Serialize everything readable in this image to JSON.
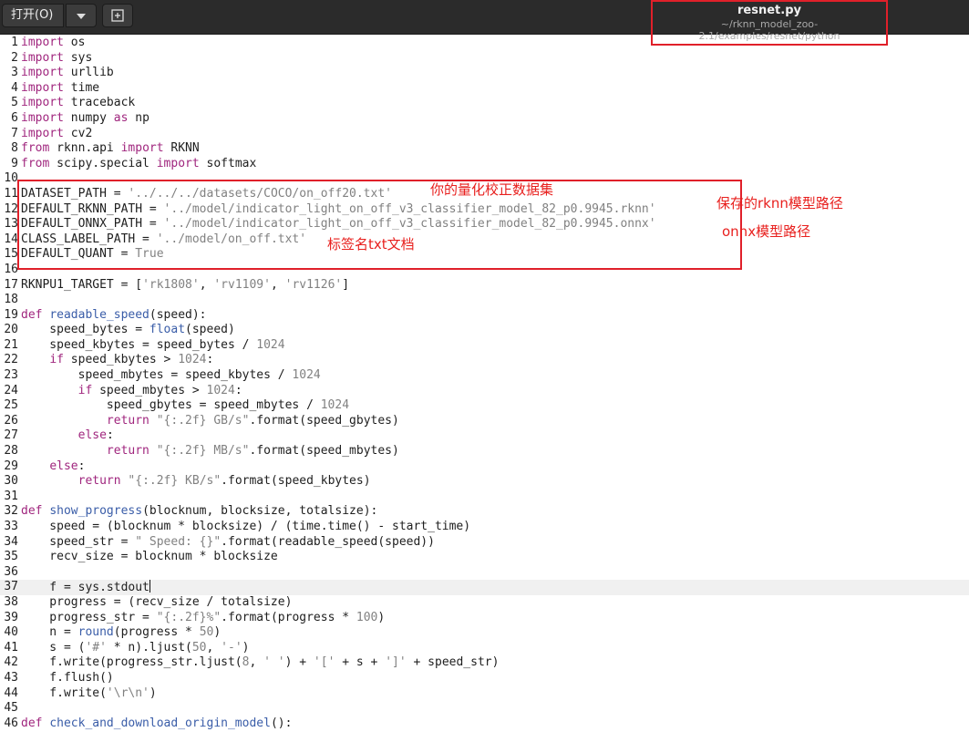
{
  "header": {
    "open_label": "打开(O)",
    "file_name": "resnet.py",
    "file_path": "~/rknn_model_zoo-2.1/examples/resnet/python"
  },
  "icons": {
    "dropdown": "chevron-down-icon",
    "new_tab": "new-tab-icon"
  },
  "colors": {
    "header_bg": "#2b2b2b",
    "annotation_red": "#e0202a",
    "keyword": "#a0267e",
    "string": "#818181",
    "builtin": "#3a5da8"
  },
  "editor": {
    "current_line": 37,
    "lines": [
      [
        {
          "t": "import",
          "c": "kw"
        },
        {
          "t": " os"
        }
      ],
      [
        {
          "t": "import",
          "c": "kw"
        },
        {
          "t": " sys"
        }
      ],
      [
        {
          "t": "import",
          "c": "kw"
        },
        {
          "t": " urllib"
        }
      ],
      [
        {
          "t": "import",
          "c": "kw"
        },
        {
          "t": " time"
        }
      ],
      [
        {
          "t": "import",
          "c": "kw"
        },
        {
          "t": " traceback"
        }
      ],
      [
        {
          "t": "import",
          "c": "kw"
        },
        {
          "t": " numpy "
        },
        {
          "t": "as",
          "c": "kw"
        },
        {
          "t": " np"
        }
      ],
      [
        {
          "t": "import",
          "c": "kw"
        },
        {
          "t": " cv2"
        }
      ],
      [
        {
          "t": "from",
          "c": "kw"
        },
        {
          "t": " rknn.api "
        },
        {
          "t": "import",
          "c": "kw"
        },
        {
          "t": " RKNN"
        }
      ],
      [
        {
          "t": "from",
          "c": "kw"
        },
        {
          "t": " scipy.special "
        },
        {
          "t": "import",
          "c": "kw"
        },
        {
          "t": " softmax"
        }
      ],
      [],
      [
        {
          "t": "DATASET_PATH = "
        },
        {
          "t": "'../../../datasets/COCO/on_off20.txt'",
          "c": "str"
        }
      ],
      [
        {
          "t": "DEFAULT_RKNN_PATH = "
        },
        {
          "t": "'../model/indicator_light_on_off_v3_classifier_model_82_p0.9945.rknn'",
          "c": "str"
        }
      ],
      [
        {
          "t": "DEFAULT_ONNX_PATH = "
        },
        {
          "t": "'../model/indicator_light_on_off_v3_classifier_model_82_p0.9945.onnx'",
          "c": "str"
        }
      ],
      [
        {
          "t": "CLASS_LABEL_PATH = "
        },
        {
          "t": "'../model/on_off.txt'",
          "c": "str"
        }
      ],
      [
        {
          "t": "DEFAULT_QUANT = "
        },
        {
          "t": "True",
          "c": "num"
        }
      ],
      [],
      [
        {
          "t": "RKNPU1_TARGET = ["
        },
        {
          "t": "'rk1808'",
          "c": "str"
        },
        {
          "t": ", "
        },
        {
          "t": "'rv1109'",
          "c": "str"
        },
        {
          "t": ", "
        },
        {
          "t": "'rv1126'",
          "c": "str"
        },
        {
          "t": "]"
        }
      ],
      [],
      [
        {
          "t": "def",
          "c": "kw"
        },
        {
          "t": " "
        },
        {
          "t": "readable_speed",
          "c": "bi"
        },
        {
          "t": "(speed):"
        }
      ],
      [
        {
          "t": "    speed_bytes = "
        },
        {
          "t": "float",
          "c": "bi"
        },
        {
          "t": "(speed)"
        }
      ],
      [
        {
          "t": "    speed_kbytes = speed_bytes / "
        },
        {
          "t": "1024",
          "c": "num"
        }
      ],
      [
        {
          "t": "    "
        },
        {
          "t": "if",
          "c": "kw"
        },
        {
          "t": " speed_kbytes > "
        },
        {
          "t": "1024",
          "c": "num"
        },
        {
          "t": ":"
        }
      ],
      [
        {
          "t": "        speed_mbytes = speed_kbytes / "
        },
        {
          "t": "1024",
          "c": "num"
        }
      ],
      [
        {
          "t": "        "
        },
        {
          "t": "if",
          "c": "kw"
        },
        {
          "t": " speed_mbytes > "
        },
        {
          "t": "1024",
          "c": "num"
        },
        {
          "t": ":"
        }
      ],
      [
        {
          "t": "            speed_gbytes = speed_mbytes / "
        },
        {
          "t": "1024",
          "c": "num"
        }
      ],
      [
        {
          "t": "            "
        },
        {
          "t": "return",
          "c": "kw"
        },
        {
          "t": " "
        },
        {
          "t": "\"{:.2f} GB/s\"",
          "c": "str"
        },
        {
          "t": ".format(speed_gbytes)"
        }
      ],
      [
        {
          "t": "        "
        },
        {
          "t": "else",
          "c": "kw"
        },
        {
          "t": ":"
        }
      ],
      [
        {
          "t": "            "
        },
        {
          "t": "return",
          "c": "kw"
        },
        {
          "t": " "
        },
        {
          "t": "\"{:.2f} MB/s\"",
          "c": "str"
        },
        {
          "t": ".format(speed_mbytes)"
        }
      ],
      [
        {
          "t": "    "
        },
        {
          "t": "else",
          "c": "kw"
        },
        {
          "t": ":"
        }
      ],
      [
        {
          "t": "        "
        },
        {
          "t": "return",
          "c": "kw"
        },
        {
          "t": " "
        },
        {
          "t": "\"{:.2f} KB/s\"",
          "c": "str"
        },
        {
          "t": ".format(speed_kbytes)"
        }
      ],
      [],
      [
        {
          "t": "def",
          "c": "kw"
        },
        {
          "t": " "
        },
        {
          "t": "show_progress",
          "c": "bi"
        },
        {
          "t": "(blocknum, blocksize, totalsize):"
        }
      ],
      [
        {
          "t": "    speed = (blocknum * blocksize) / (time.time() - start_time)"
        }
      ],
      [
        {
          "t": "    speed_str = "
        },
        {
          "t": "\" Speed: {}\"",
          "c": "str"
        },
        {
          "t": ".format(readable_speed(speed))"
        }
      ],
      [
        {
          "t": "    recv_size = blocknum * blocksize"
        }
      ],
      [],
      [
        {
          "t": "    f = sys.stdout"
        }
      ],
      [
        {
          "t": "    progress = (recv_size / totalsize)"
        }
      ],
      [
        {
          "t": "    progress_str = "
        },
        {
          "t": "\"{:.2f}%\"",
          "c": "str"
        },
        {
          "t": ".format(progress * "
        },
        {
          "t": "100",
          "c": "num"
        },
        {
          "t": ")"
        }
      ],
      [
        {
          "t": "    n = "
        },
        {
          "t": "round",
          "c": "bi"
        },
        {
          "t": "(progress * "
        },
        {
          "t": "50",
          "c": "num"
        },
        {
          "t": ")"
        }
      ],
      [
        {
          "t": "    s = ("
        },
        {
          "t": "'#'",
          "c": "str"
        },
        {
          "t": " * n).ljust("
        },
        {
          "t": "50",
          "c": "num"
        },
        {
          "t": ", "
        },
        {
          "t": "'-'",
          "c": "str"
        },
        {
          "t": ")"
        }
      ],
      [
        {
          "t": "    f.write(progress_str.ljust("
        },
        {
          "t": "8",
          "c": "num"
        },
        {
          "t": ", "
        },
        {
          "t": "' '",
          "c": "str"
        },
        {
          "t": ") + "
        },
        {
          "t": "'['",
          "c": "str"
        },
        {
          "t": " + s + "
        },
        {
          "t": "']'",
          "c": "str"
        },
        {
          "t": " + speed_str)"
        }
      ],
      [
        {
          "t": "    f.flush()"
        }
      ],
      [
        {
          "t": "    f.write("
        },
        {
          "t": "'\\r\\n'",
          "c": "str"
        },
        {
          "t": ")"
        }
      ],
      [],
      [
        {
          "t": "def",
          "c": "kw"
        },
        {
          "t": " "
        },
        {
          "t": "check_and_download_origin_model",
          "c": "bi"
        },
        {
          "t": "():"
        }
      ]
    ]
  },
  "annotations": {
    "dataset_note": "你的量化校正数据集",
    "rknn_note": "保存的rknn模型路径",
    "onnx_note": "onnx模型路径",
    "label_note": "标签名txt文档"
  }
}
